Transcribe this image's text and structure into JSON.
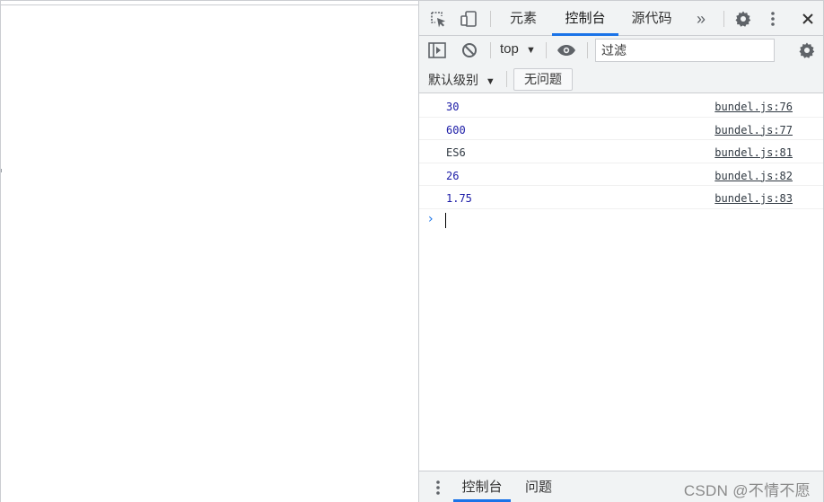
{
  "devtools": {
    "tabs": [
      {
        "label": "元素"
      },
      {
        "label": "控制台"
      },
      {
        "label": "源代码"
      }
    ],
    "more_tabs_glyph": "»",
    "toolbar": {
      "context": "top",
      "filter_placeholder": "过滤",
      "log_level": "默认级别",
      "issues_label": "无问题"
    },
    "console_messages": [
      {
        "value": "30",
        "source": "bundel.js:76"
      },
      {
        "value": "600",
        "source": "bundel.js:77"
      },
      {
        "value": "ES6",
        "source": "bundel.js:81"
      },
      {
        "value": "26",
        "source": "bundel.js:82"
      },
      {
        "value": "1.75",
        "source": "bundel.js:83"
      }
    ],
    "drawer": {
      "tabs": [
        {
          "label": "控制台"
        },
        {
          "label": "问题"
        }
      ]
    }
  },
  "watermark": "CSDN @不情不愿",
  "icons": [
    "inspect-icon",
    "device-toggle-icon",
    "settings-icon",
    "kebab-menu-icon",
    "close-icon",
    "sidebar-toggle-icon",
    "clear-console-icon",
    "eye-icon",
    "chevron-prompt-icon"
  ],
  "colors": {
    "accent": "#1a73e8",
    "number_value": "#1a1aa6",
    "toolbar_bg": "#f1f3f4"
  }
}
